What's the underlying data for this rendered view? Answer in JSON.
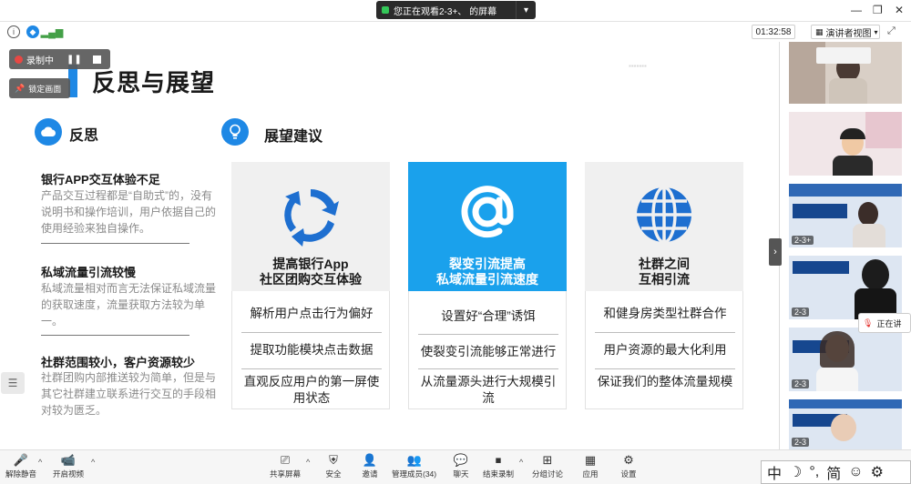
{
  "titlebar": {
    "share_text": "您正在观看2-3+、      的屏幕"
  },
  "infobar": {
    "timer": "01:32:58",
    "speaker_view": "演讲者视图"
  },
  "recording": {
    "label": "录制中"
  },
  "pin": {
    "label": "锁定画面"
  },
  "slide": {
    "title": "反思与展望",
    "reflection_title": "反思",
    "outlook_title": "展望建议",
    "reflections": [
      {
        "head": "银行APP交互体验不足",
        "body": "产品交互过程都是“自助式”的，没有说明书和操作培训，用户依据自己的使用经验来独自操作。"
      },
      {
        "head": "私域流量引流较慢",
        "body": "私域流量相对而言无法保证私域流量的获取速度，流量获取方法较为单一。"
      },
      {
        "head": "社群范围较小，客户资源较少",
        "body": "社群团购内部推送较为简单，但是与其它社群建立联系进行交互的手段相对较为匮乏。"
      }
    ],
    "cards": [
      {
        "title_line1": "提高银行App",
        "title_line2": "社区团购交互体验",
        "items": [
          "解析用户点击行为偏好",
          "提取功能模块点击数据",
          "直观反应用户的第一屏使用状态"
        ]
      },
      {
        "title_line1": "裂变引流提高",
        "title_line2": "私域流量引流速度",
        "items": [
          "设置好“合理”诱饵",
          "使裂变引流能够正常进行",
          "从流量源头进行大规模引流"
        ]
      },
      {
        "title_line1": "社群之间",
        "title_line2": "互相引流",
        "items": [
          "和健身房类型社群合作",
          "用户资源的最大化利用",
          "保证我们的整体流量规模"
        ]
      }
    ]
  },
  "panel": {
    "tiles": [
      {
        "name": ""
      },
      {
        "name": ""
      },
      {
        "name": "2-3+"
      },
      {
        "name": "2-3"
      },
      {
        "name": "2-3"
      },
      {
        "name": "2-3"
      }
    ],
    "talking": "正在讲"
  },
  "toolbar": {
    "mute": "解除静音",
    "video": "开启视频",
    "share": "共享屏幕",
    "security": "安全",
    "invite": "邀请",
    "participants": "管理成员(34)",
    "chat": "聊天",
    "end_record": "结束录制",
    "breakout": "分组讨论",
    "apps": "应用",
    "settings": "设置"
  },
  "ime": {
    "items": [
      "中",
      "☽",
      "°,",
      "简",
      "☺",
      "⚙"
    ]
  },
  "colors": {
    "accent": "#1e88e5",
    "card_blue": "#1aa1ec",
    "record_red": "#e53935"
  }
}
